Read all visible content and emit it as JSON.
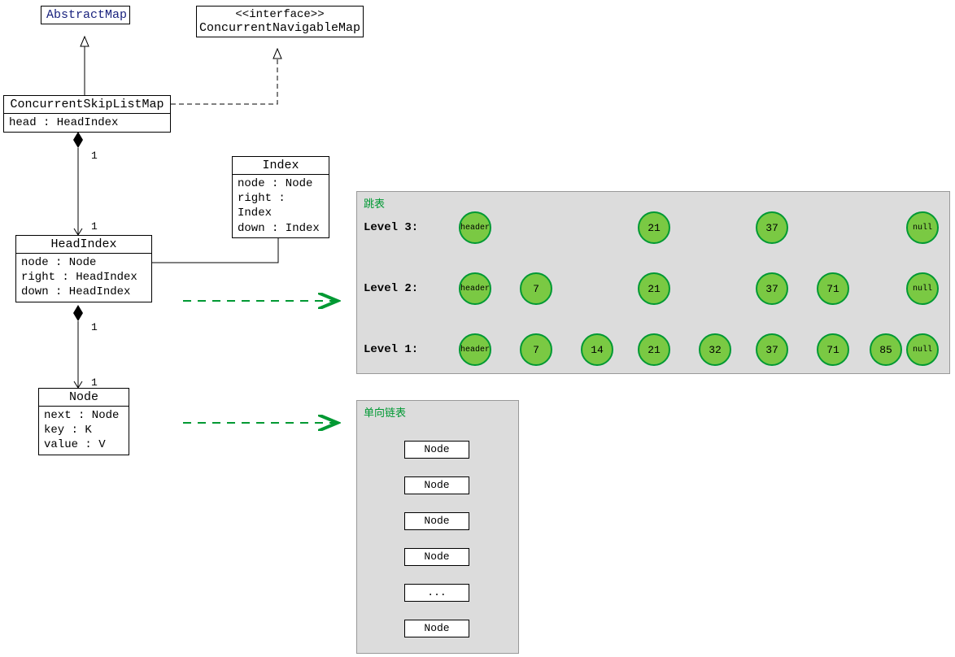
{
  "uml": {
    "abstractMap": {
      "title": "AbstractMap"
    },
    "concurrentNavigableMap": {
      "stereotype": "<<interface>>",
      "title": "ConcurrentNavigableMap"
    },
    "concurrentSkipListMap": {
      "title": "ConcurrentSkipListMap",
      "fields": "head : HeadIndex"
    },
    "index": {
      "title": "Index",
      "f1": "node : Node",
      "f2": "right : Index",
      "f3": "down : Index"
    },
    "headIndex": {
      "title": "HeadIndex",
      "f1": "node : Node",
      "f2": "right : HeadIndex",
      "f3": "down : HeadIndex"
    },
    "node": {
      "title": "Node",
      "f1": "next : Node",
      "f2": "key : K",
      "f3": "value : V"
    },
    "mult": {
      "one": "1"
    }
  },
  "skiplist": {
    "title": "跳表",
    "levels": {
      "l3": "Level 3:",
      "l2": "Level 2:",
      "l1": "Level 1:"
    },
    "header": "header",
    "null": "null",
    "values": {
      "v7": "7",
      "v14": "14",
      "v21": "21",
      "v32": "32",
      "v37": "37",
      "v71": "71",
      "v85": "85"
    }
  },
  "linkedlist": {
    "title": "单向链表",
    "node": "Node",
    "ellipsis": "..."
  },
  "chart_data": {
    "type": "table",
    "title": "ConcurrentSkipListMap class diagram and skip-list illustration",
    "uml_classes": [
      {
        "name": "AbstractMap",
        "kind": "class",
        "fields": []
      },
      {
        "name": "ConcurrentNavigableMap",
        "kind": "interface",
        "fields": []
      },
      {
        "name": "ConcurrentSkipListMap",
        "kind": "class",
        "fields": [
          "head : HeadIndex"
        ]
      },
      {
        "name": "Index",
        "kind": "class",
        "fields": [
          "node : Node",
          "right : Index",
          "down : Index"
        ]
      },
      {
        "name": "HeadIndex",
        "kind": "class",
        "fields": [
          "node : Node",
          "right : HeadIndex",
          "down : HeadIndex"
        ]
      },
      {
        "name": "Node",
        "kind": "class",
        "fields": [
          "next : Node",
          "key : K",
          "value : V"
        ]
      }
    ],
    "uml_relationships": [
      {
        "from": "ConcurrentSkipListMap",
        "to": "AbstractMap",
        "type": "generalization"
      },
      {
        "from": "ConcurrentSkipListMap",
        "to": "ConcurrentNavigableMap",
        "type": "realization"
      },
      {
        "from": "ConcurrentSkipListMap",
        "to": "HeadIndex",
        "type": "composition",
        "multiplicity": [
          "1",
          "1"
        ]
      },
      {
        "from": "HeadIndex",
        "to": "Index",
        "type": "generalization"
      },
      {
        "from": "HeadIndex",
        "to": "Node",
        "type": "composition",
        "multiplicity": [
          "1",
          "1"
        ]
      }
    ],
    "skip_list_levels": [
      {
        "level": 3,
        "nodes": [
          "header",
          21,
          37,
          "null"
        ]
      },
      {
        "level": 2,
        "nodes": [
          "header",
          7,
          21,
          37,
          71,
          "null"
        ]
      },
      {
        "level": 1,
        "nodes": [
          "header",
          7,
          14,
          21,
          32,
          37,
          71,
          85,
          "null"
        ]
      }
    ],
    "linked_list_nodes": [
      "Node",
      "Node",
      "Node",
      "...",
      "Node"
    ]
  }
}
